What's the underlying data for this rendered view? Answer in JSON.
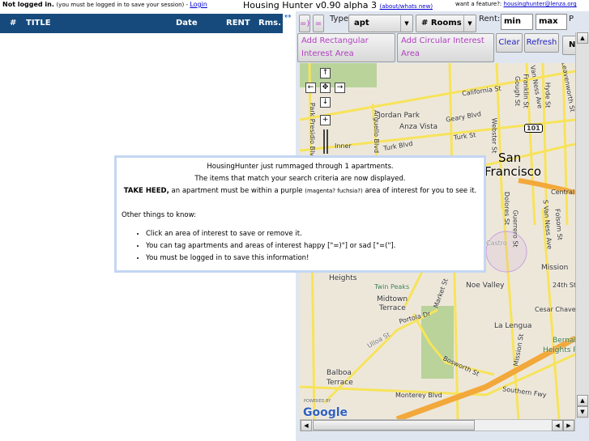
{
  "header": {
    "login_status": "Not logged in.",
    "login_note": "(you must be logged in to save your session) - ",
    "login_link": "Login",
    "title": "Housing Hunter v0.90 alpha 3",
    "about_link": "(about/whats new)",
    "feature_text": "want a feature?: ",
    "feature_email": "housinghunter@lenza.org"
  },
  "table": {
    "columns": [
      "#",
      "TITLE",
      "Date",
      "RENT",
      "Rms."
    ]
  },
  "toolbar": {
    "happy": "=)",
    "sad": "=(",
    "type_label": "Type:",
    "type_value": "apt",
    "rooms_value": "# Rooms",
    "rent_label": "Rent:",
    "rent_min": "min",
    "rent_max": "max",
    "cut_label": "P",
    "add_rect": "Add Rectangular Interest Area",
    "add_circ": "Add Circular Interest Area",
    "clear": "Clear",
    "refresh": "Refresh",
    "next_cut": "Ne"
  },
  "map": {
    "labels": [
      "California St",
      "Jordan Park",
      "Anza Vista",
      "Geary Blvd",
      "Turk St",
      "Turk Blvd",
      "Arguello Blvd",
      "Park Presidio Blvd",
      "Webster St",
      "Gough St",
      "Franklin St",
      "Van Ness Ave",
      "Hyde St",
      "Leavenworth St",
      "101",
      "San",
      "Francisco",
      "Inner",
      "Central F",
      "Dolores St",
      "Guerrero St",
      "S Van Ness Ave",
      "Folsom St",
      "Castro",
      "Mission",
      "24th St",
      "Noe Valley",
      "Twin Peaks",
      "Midtown",
      "Terrace",
      "Heights",
      "Portola Dr",
      "Ulloa St",
      "Market St",
      "Cesar Chavez",
      "La Lengua",
      "Mission St",
      "Bernal",
      "Heights Park",
      "Bosworth St",
      "Balboa",
      "Terrace",
      "Monterey Blvd",
      "Southern Fwy",
      "POWERED BY",
      "Google"
    ],
    "nav": {
      "up": "↑",
      "down": "↓",
      "left": "←",
      "right": "→",
      "center": "✥",
      "zoom_in": "+"
    }
  },
  "dialog": {
    "line1": "HousingHunter just rummaged through 1 apartments.",
    "line2": "The items that match your search criteria are now displayed.",
    "heed_bold": "TAKE HEED,",
    "heed_a": " an apartment must be within a purple ",
    "heed_small": "(magenta? fuchsia?)",
    "heed_b": " area of interest for you to see it.",
    "other": "Other things to know:",
    "bullets": [
      "Click an area of interest to save or remove it.",
      "You can tag apartments and areas of interest happy [\"=)\"] or sad [\"=(\"].",
      "You must be logged in to save this information!"
    ]
  },
  "colors": {
    "table_header": "#164a7c",
    "tag_text": "#b040c0",
    "dialog_border": "#c4d6f2",
    "map_bg": "#ede7da",
    "road": "#f7e35a",
    "freeway": "#f2a83a"
  }
}
